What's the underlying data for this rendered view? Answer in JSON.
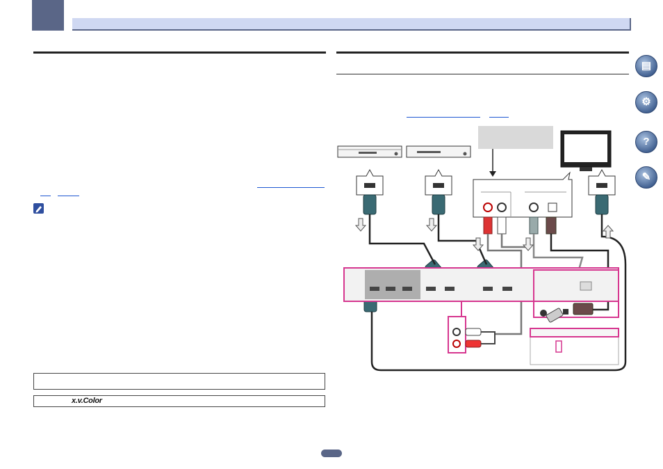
{
  "links": {
    "left_link_1": "",
    "left_link_2": "",
    "left_link_3": "",
    "right_link_1": "",
    "right_link_2": ""
  },
  "boxes": {
    "box2_label": "x.v.Color"
  },
  "side_icons": [
    {
      "icon": "book-icon"
    },
    {
      "icon": "remote-settings-icon"
    },
    {
      "icon": "troubleshooting-icon"
    },
    {
      "icon": "tools-icon"
    }
  ],
  "colors": {
    "accent": "#5a6687",
    "header_bar": "#cfd8f2",
    "highlight": "#d6368f",
    "cable": "#3a6a73",
    "link": "#1d57d1"
  }
}
